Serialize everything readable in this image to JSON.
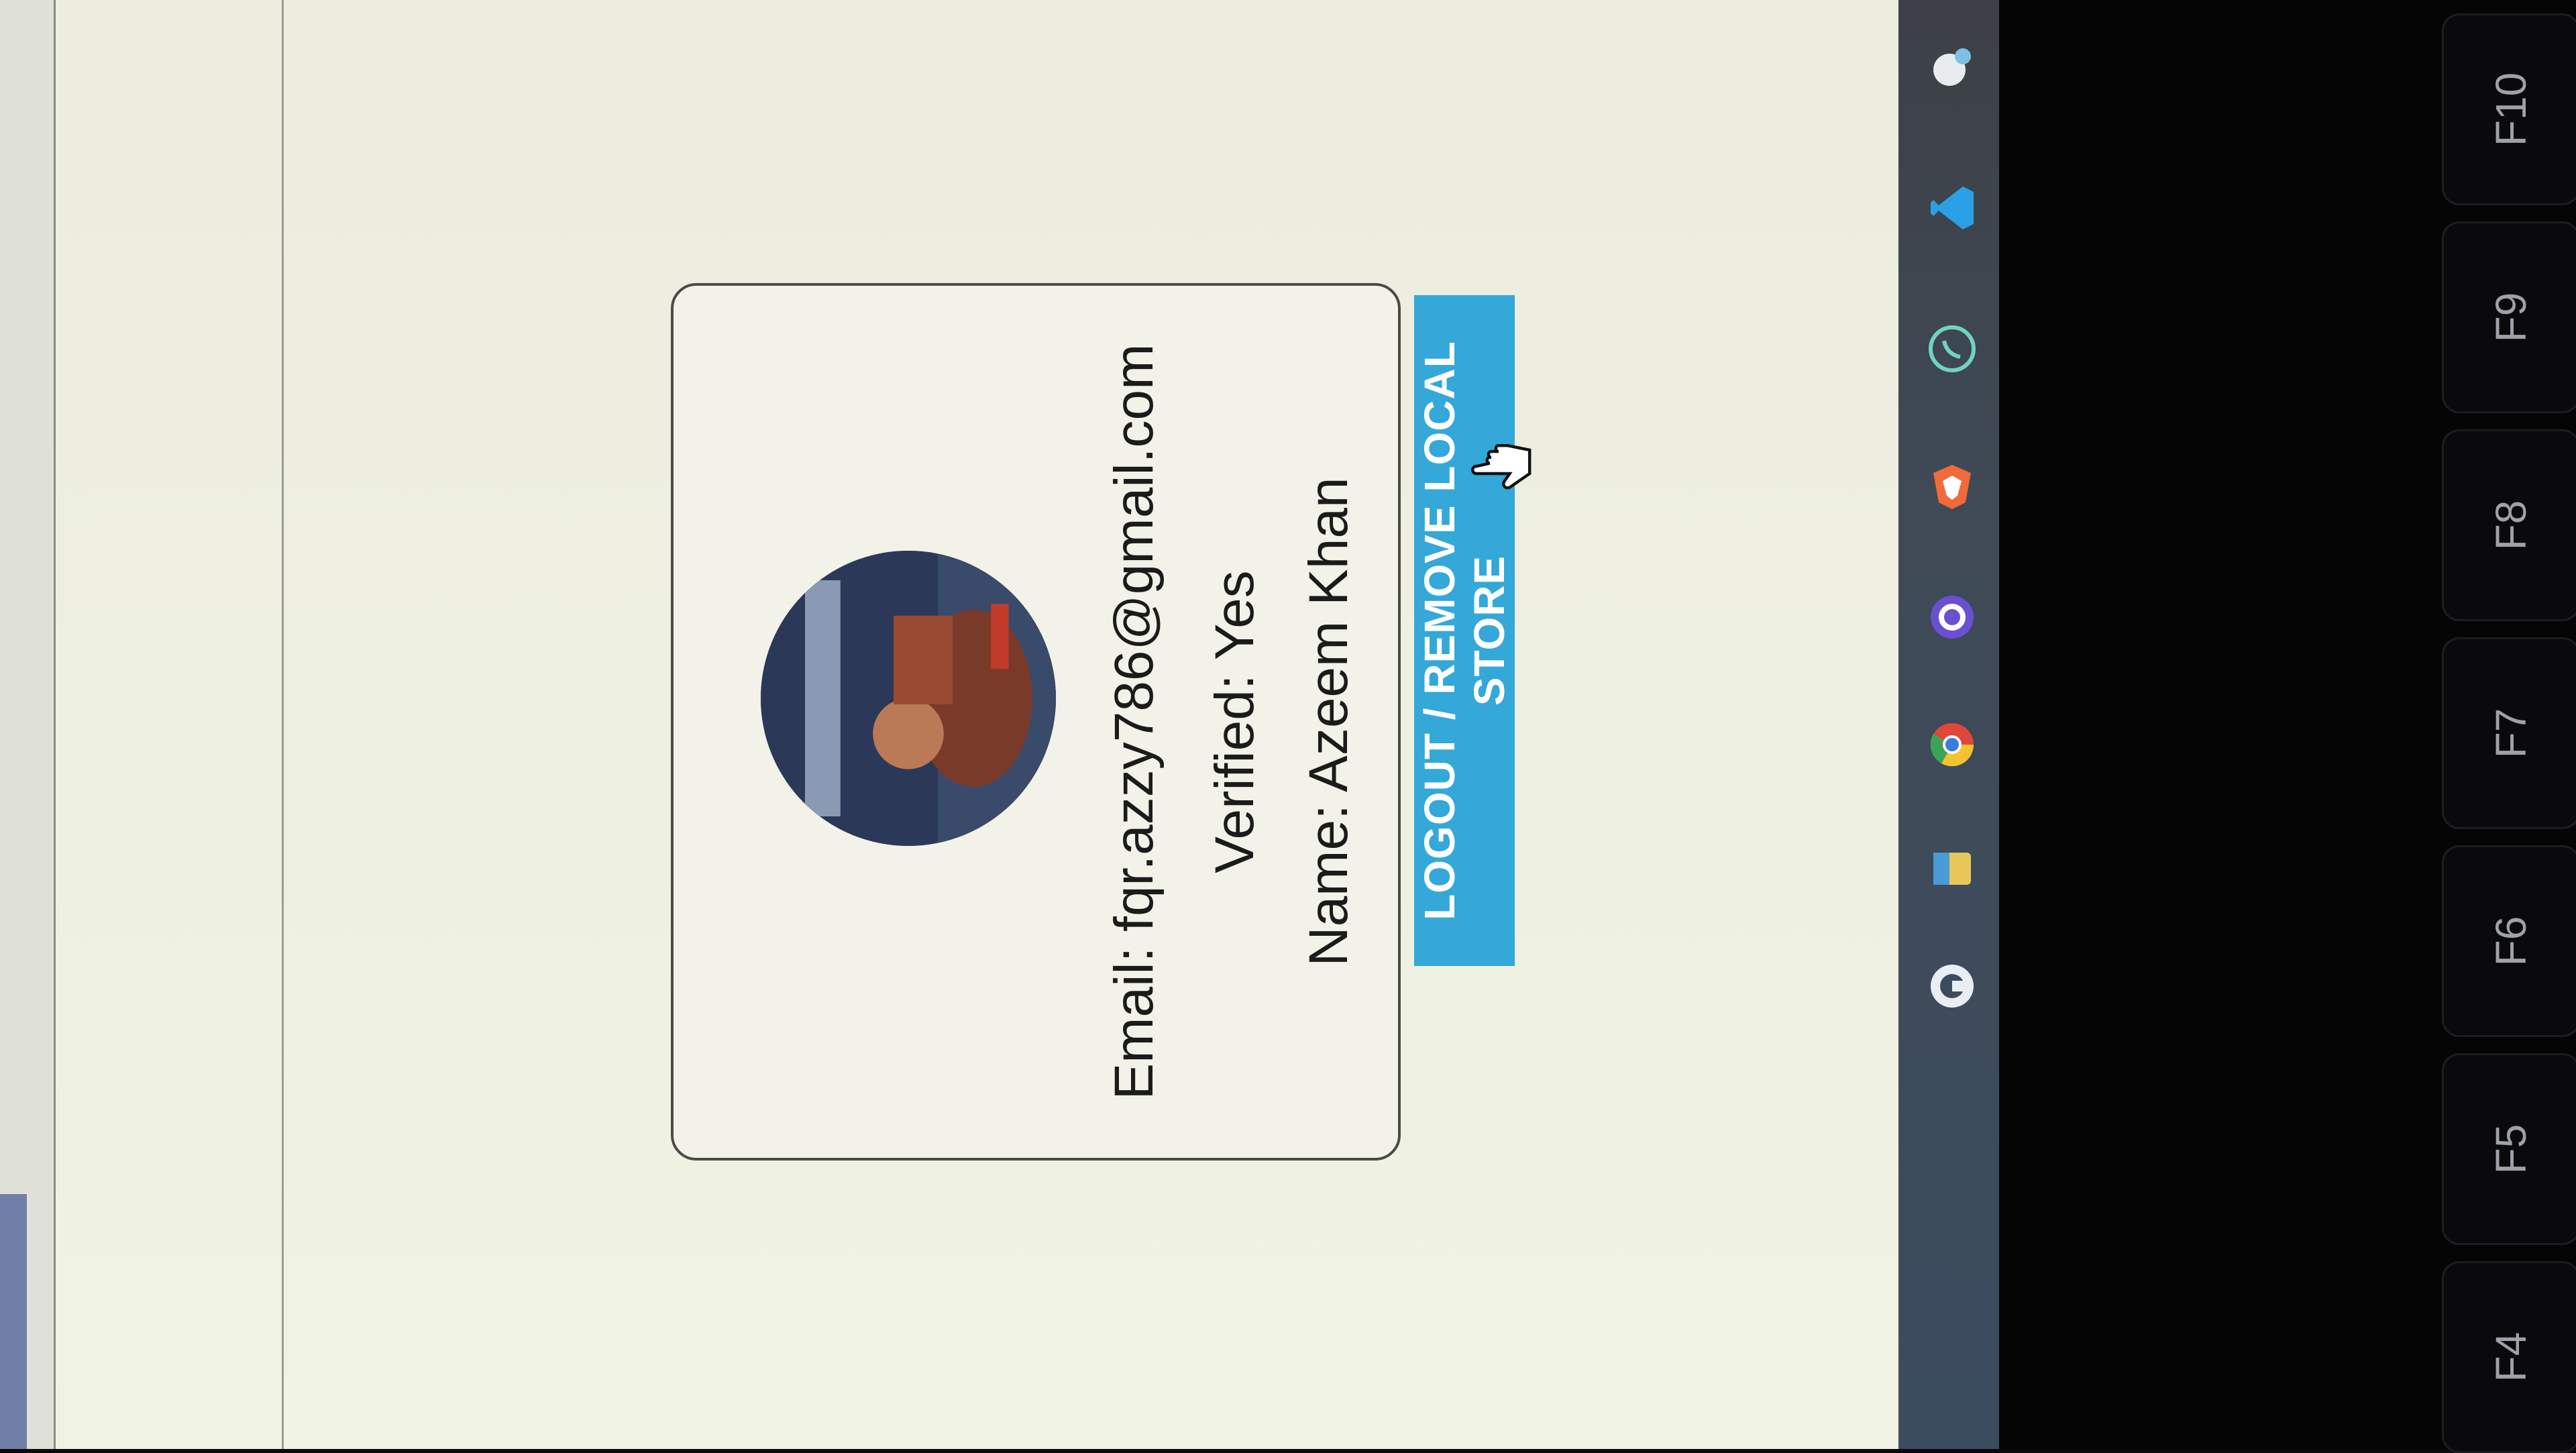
{
  "profile": {
    "email_line": "Email: fqr.azzy786@gmail.com",
    "verified_line": "Verified: Yes",
    "name_line": "Name: Azeem Khan"
  },
  "logout_button": {
    "label": "LOGOUT / REMOVE LOCAL STORE"
  },
  "taskbar": {
    "icons": [
      "copilot-icon",
      "file-explorer-icon",
      "chrome-icon",
      "app-icon",
      "brave-icon",
      "whatsapp-icon",
      "vscode-icon",
      "notification-icon"
    ]
  },
  "keyboard": {
    "keys": [
      "F4",
      "F5",
      "F6",
      "F7",
      "F8",
      "F9",
      "F10"
    ]
  },
  "colors": {
    "button": "#33a8d9",
    "card_border": "#4a4a48",
    "taskbar": "#3f4a56"
  }
}
